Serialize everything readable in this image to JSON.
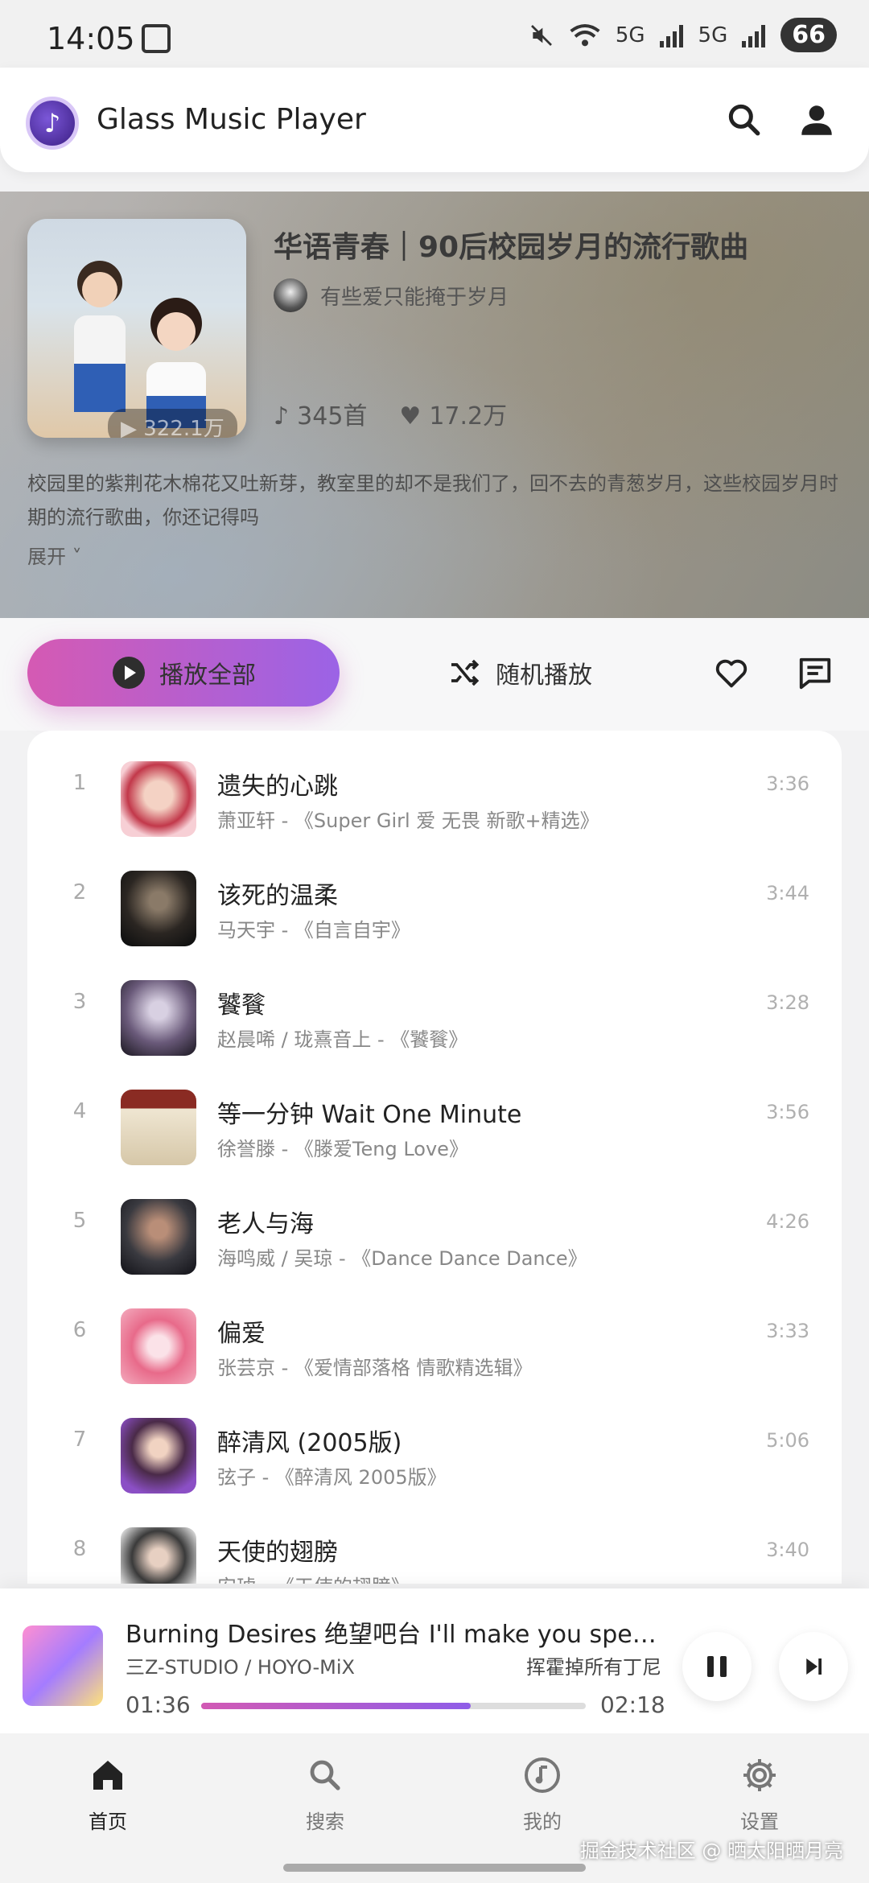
{
  "status": {
    "time": "14:05",
    "battery": "66",
    "net1": "5G",
    "net2": "5G",
    "wifi_tag": "5"
  },
  "app": {
    "title": "Glass Music Player"
  },
  "playlist": {
    "title": "华语青春｜90后校园岁月的流行歌曲",
    "creator": "有些爱只能掩于岁月",
    "play_count": "322.1万",
    "song_count": "345首",
    "likes": "17.2万",
    "description": "校园里的紫荆花木棉花又吐新芽，教室里的却不是我们了，回不去的青葱岁月，这些校园岁月时期的流行歌曲，你还记得吗",
    "expand_label": "展开"
  },
  "actions": {
    "play_all": "播放全部",
    "shuffle": "随机播放"
  },
  "songs": [
    {
      "index": "1",
      "name": "遗失的心跳",
      "sub": "萧亚轩 - 《Super Girl 爱 无畏 新歌+精选》",
      "duration": "3:36"
    },
    {
      "index": "2",
      "name": "该死的温柔",
      "sub": "马天宇 - 《自言自宇》",
      "duration": "3:44"
    },
    {
      "index": "3",
      "name": "饕餮",
      "sub": "赵晨唏 / 珑熹音上 - 《饕餮》",
      "duration": "3:28"
    },
    {
      "index": "4",
      "name": "等一分钟 Wait One Minute",
      "sub": "徐誉滕 - 《滕爱Teng Love》",
      "duration": "3:56"
    },
    {
      "index": "5",
      "name": "老人与海",
      "sub": "海鸣威 / 吴琼 - 《Dance Dance Dance》",
      "duration": "4:26"
    },
    {
      "index": "6",
      "name": "偏爱",
      "sub": "张芸京 - 《爱情部落格 情歌精选辑》",
      "duration": "3:33"
    },
    {
      "index": "7",
      "name": "醉清风 (2005版)",
      "sub": "弦子 - 《醉清风 2005版》",
      "duration": "5:06"
    },
    {
      "index": "8",
      "name": "天使的翅膀",
      "sub": "安琥 - 《天使的翅膀》",
      "duration": "3:40"
    }
  ],
  "player": {
    "title": "Burning Desires 绝望吧台   I'll make you spend the night",
    "artist": "三Z-STUDIO / HOYO-MiX",
    "lyric": "挥霍掉所有丁尼",
    "current": "01:36",
    "total": "02:18",
    "progress_fraction": 0.7
  },
  "nav": [
    {
      "label": "首页",
      "icon": "home-icon"
    },
    {
      "label": "搜索",
      "icon": "search-icon"
    },
    {
      "label": "我的",
      "icon": "music-note-icon"
    },
    {
      "label": "设置",
      "icon": "settings-icon"
    }
  ],
  "watermark": "掘金技术社区 @ 晒太阳晒月亮",
  "colors": {
    "accent_start": "#d55ab3",
    "accent_end": "#9b63e6"
  }
}
